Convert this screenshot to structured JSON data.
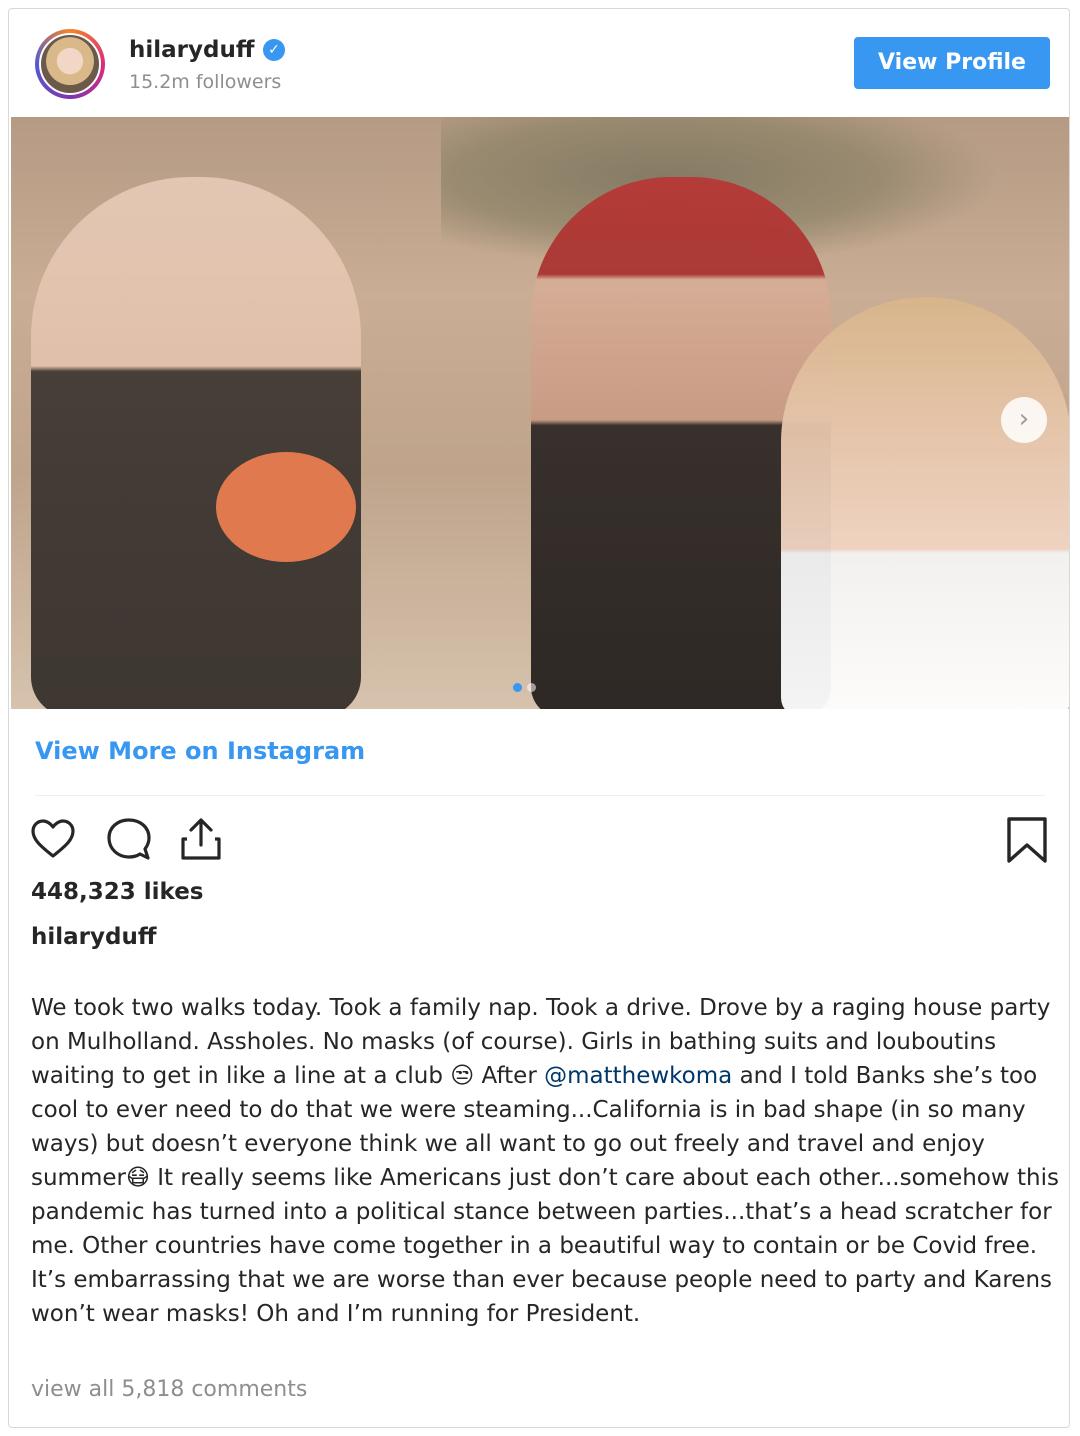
{
  "header": {
    "username": "hilaryduff",
    "verified_icon": "verified-badge-icon",
    "followers": "15.2m followers",
    "view_profile": "View Profile"
  },
  "media": {
    "next_icon": "chevron-right-icon",
    "slides_total": 2,
    "slide_active": 1
  },
  "links": {
    "view_more": "View More on Instagram"
  },
  "actions": {
    "like_icon": "heart-icon",
    "comment_icon": "comment-icon",
    "share_icon": "share-icon",
    "save_icon": "bookmark-icon"
  },
  "post": {
    "likes": "448,323 likes",
    "caption_user": "hilaryduff",
    "caption_before_mention": "We took two walks today. Took a family nap. Took a drive. Drove by a raging house party on Mulholland. Assholes. No masks (of course). Girls in bathing suits and louboutins waiting to get in like a line at a club 😒 After ",
    "mention": "@matthewkoma",
    "caption_after_mention": " and I told Banks she’s too cool to ever need to do that we were steaming...California is in bad shape (in so many ways) but doesn’t everyone think we all want to go out freely and travel and enjoy summer😷 It really seems like Americans just don’t care about each other...somehow this pandemic has turned into a political stance between parties...that’s a head scratcher for me. Other countries have come together in a beautiful way to contain or be Covid free. It’s embarrassing that we are worse than ever because people need to party and Karens won’t wear masks! Oh and I’m running for President.",
    "view_comments": "view all 5,818 comments"
  },
  "colors": {
    "accent": "#3897f0",
    "text": "#262626",
    "muted": "#8e8e8e"
  }
}
